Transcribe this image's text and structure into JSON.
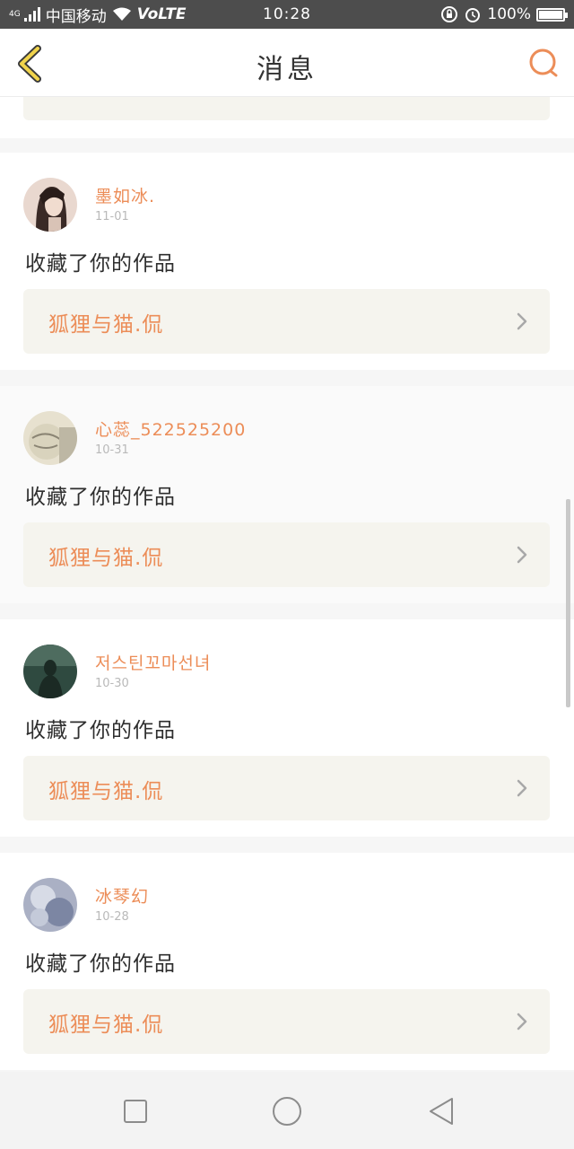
{
  "status_bar": {
    "network_tag": "4G",
    "carrier": "中国移动",
    "volte": "VoLTE",
    "time": "10:28",
    "battery": "100%",
    "battery_level": 1.0
  },
  "header": {
    "title": "消息",
    "back_icon": "chevron-left-icon",
    "search_icon": "search-icon"
  },
  "colors": {
    "accent": "#ec8d58",
    "back_arrow": "#f1d44c",
    "work_bg": "#f5f4ee"
  },
  "notifications": [
    {
      "username": "墨如冰.",
      "date": "11-01",
      "action": "收藏了你的作品",
      "work_title": "狐狸与猫.侃"
    },
    {
      "username": "心蕊_522525200",
      "date": "10-31",
      "action": "收藏了你的作品",
      "work_title": "狐狸与猫.侃"
    },
    {
      "username": "저스틴꼬마선녀",
      "date": "10-30",
      "action": "收藏了你的作品",
      "work_title": "狐狸与猫.侃"
    },
    {
      "username": "冰琴幻",
      "date": "10-28",
      "action": "收藏了你的作品",
      "work_title": "狐狸与猫.侃"
    }
  ],
  "nav": {
    "recent_icon": "square-icon",
    "home_icon": "circle-icon",
    "back_icon": "triangle-back-icon"
  }
}
